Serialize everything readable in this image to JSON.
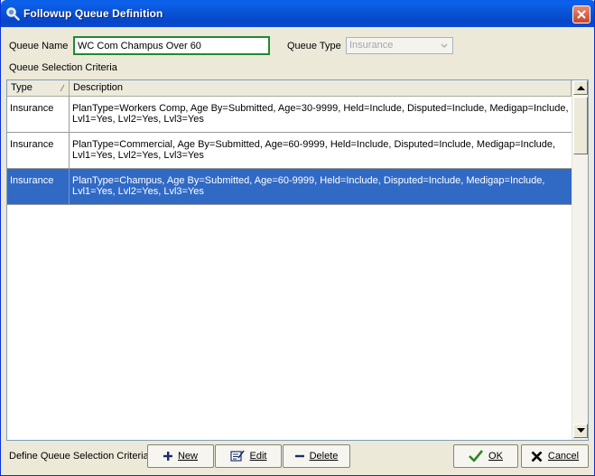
{
  "window": {
    "title": "Followup Queue Definition"
  },
  "form": {
    "queue_name_label": "Queue Name",
    "queue_name_value": "WC Com Champus Over 60",
    "queue_type_label": "Queue Type",
    "queue_type_value": "Insurance",
    "criteria_label": "Queue Selection Criteria"
  },
  "grid": {
    "columns": [
      "Type",
      "Description"
    ],
    "rows": [
      {
        "type": "Insurance",
        "description": "PlanType=Workers Comp, Age By=Submitted, Age=30-9999, Held=Include, Disputed=Include, Medigap=Include, Lvl1=Yes, Lvl2=Yes, Lvl3=Yes",
        "selected": false
      },
      {
        "type": "Insurance",
        "description": "PlanType=Commercial, Age By=Submitted, Age=60-9999, Held=Include, Disputed=Include, Medigap=Include, Lvl1=Yes, Lvl2=Yes, Lvl3=Yes",
        "selected": false
      },
      {
        "type": "Insurance",
        "description": "PlanType=Champus, Age By=Submitted, Age=60-9999, Held=Include, Disputed=Include, Medigap=Include, Lvl1=Yes, Lvl2=Yes, Lvl3=Yes",
        "selected": true
      }
    ]
  },
  "footer": {
    "define_label": "Define Queue Selection Criteria",
    "new_label": "New",
    "edit_label": "Edit",
    "delete_label": "Delete",
    "ok_label": "OK",
    "cancel_label": "Cancel"
  },
  "icons": {
    "title": "magnifier-icon",
    "close": "close-icon",
    "new": "plus-icon",
    "edit": "edit-form-icon",
    "delete": "minus-icon",
    "ok": "checkmark-icon",
    "cancel": "x-icon"
  },
  "colors": {
    "titlebar": "#0a55d8",
    "selection": "#316ac5",
    "input_focus_border": "#1f8a2f",
    "ok_check": "#2a8a2a"
  }
}
